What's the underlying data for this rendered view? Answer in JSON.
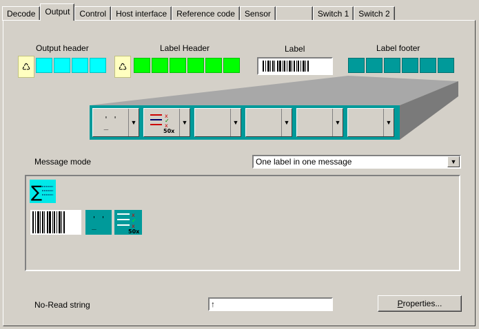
{
  "tabs": [
    {
      "label": "Decode"
    },
    {
      "label": "Output"
    },
    {
      "label": "Control"
    },
    {
      "label": "Host interface"
    },
    {
      "label": "Reference code"
    },
    {
      "label": "Sensor"
    },
    {
      "label": ""
    },
    {
      "label": "Switch 1"
    },
    {
      "label": "Switch 2"
    }
  ],
  "active_tab": "Output",
  "sections": {
    "output_header": "Output header",
    "label_header": "Label Header",
    "label": "Label",
    "label_footer": "Label footer"
  },
  "icons": {
    "reset_header": "recycle-icon",
    "reset_label_header": "recycle-icon",
    "slot1": "face-icon",
    "slot2": "checklist-50-icon",
    "sum": "sum-icon",
    "barcode": "barcode-icon",
    "face": "face-icon",
    "checklist": "checklist-50-icon"
  },
  "colors": {
    "cyan": "#00ffff",
    "green": "#00ff00",
    "teal": "#009a9a",
    "yellow": "#ffffc0"
  },
  "message_mode": {
    "label": "Message mode",
    "value": "One label in one message"
  },
  "noread": {
    "label": "No-Read string",
    "value": "↑"
  },
  "properties_button": {
    "label_u": "P",
    "label_rest": "roperties..."
  }
}
